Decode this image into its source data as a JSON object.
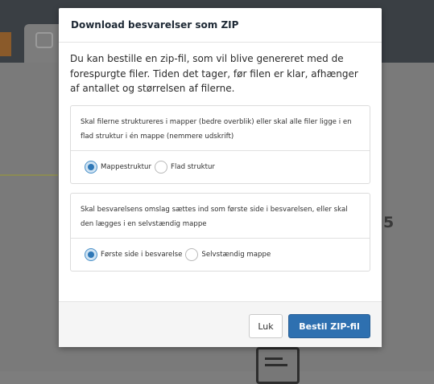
{
  "background": {
    "number_fragment": "5"
  },
  "modal": {
    "title": "Download besvarelser som ZIP",
    "intro": "Du kan bestille en zip-fil, som vil blive genereret med de forespurgte filer. Tiden det tager, før filen er klar, afhænger af antallet og størrelsen af filerne.",
    "groups": [
      {
        "question": "Skal filerne struktureres i mapper (bedre overblik) eller skal alle filer ligge i en flad struktur i én mappe (nemmere udskrift)",
        "options": [
          {
            "label": "Mappestruktur",
            "checked": true
          },
          {
            "label": "Flad struktur",
            "checked": false
          }
        ]
      },
      {
        "question": "Skal besvarelsens omslag sættes ind som første side i besvarelsen, eller skal den lægges i en selvstændig mappe",
        "options": [
          {
            "label": "Første side i besvarelse",
            "checked": true
          },
          {
            "label": "Selvstændig mappe",
            "checked": false
          }
        ]
      }
    ],
    "footer": {
      "close_label": "Luk",
      "order_label": "Bestil ZIP-fil"
    }
  },
  "colors": {
    "primary_button": "#2e70b0",
    "radio_checked": "#2f78b7",
    "overlay": "#7a7a7a"
  }
}
